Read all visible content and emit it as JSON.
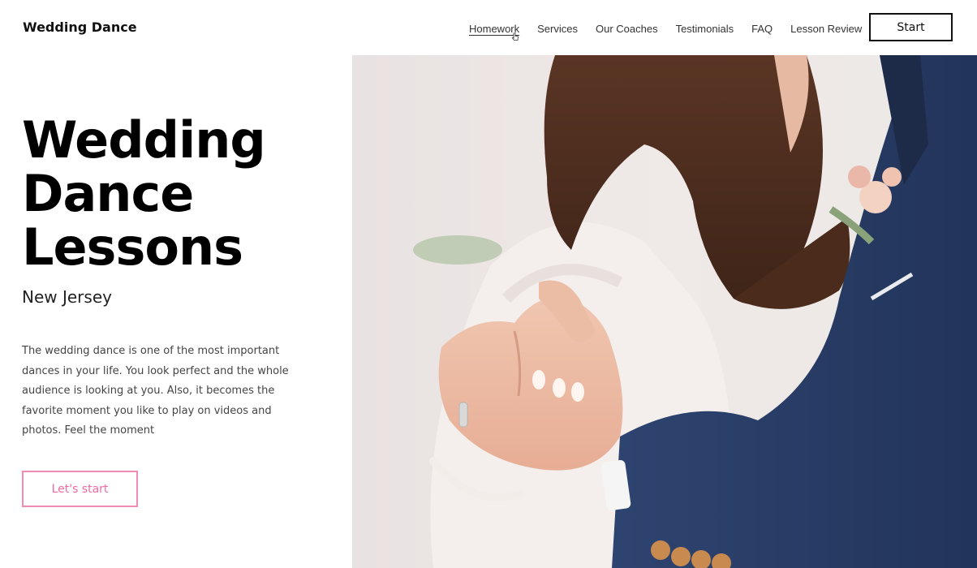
{
  "header": {
    "brand": "Wedding Dance",
    "nav": [
      "Homework",
      "Services",
      "Our Coaches",
      "Testimonials",
      "FAQ",
      "Lesson Review"
    ],
    "start_label": "Start"
  },
  "hero": {
    "title_lines": [
      "Wedding",
      "Dance",
      "Lessons"
    ],
    "location": "New Jersey",
    "description": "The wedding dance is one of the most important dances in your life. You look perfect and the whole audience is looking at you. Also, it becomes the favorite moment you like to play on videos and photos. Feel the moment",
    "cta_label": "Let's start"
  },
  "colors": {
    "accent_pink": "#ef6aa3",
    "suit_navy": "#2b3f63"
  }
}
